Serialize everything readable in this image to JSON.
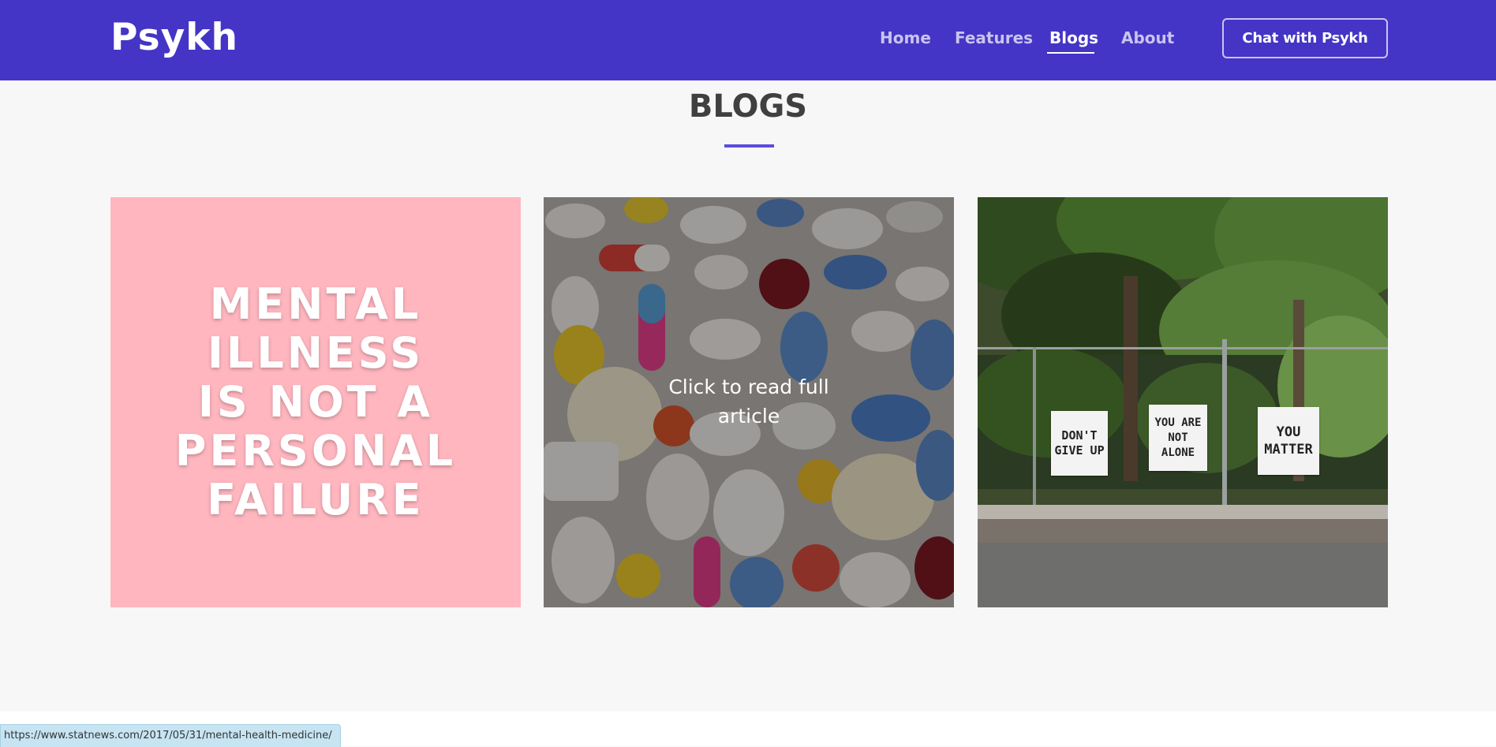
{
  "navbar": {
    "brand": "Psykh",
    "links": [
      {
        "label": "Home",
        "active": false
      },
      {
        "label": "Features",
        "active": false
      },
      {
        "label": "Blogs",
        "active": true
      },
      {
        "label": "About",
        "active": false
      }
    ],
    "cta_label": "Chat with Psykh",
    "background_color": "#4435c6"
  },
  "section": {
    "title": "BLOGS",
    "accent_color": "#5a4de0"
  },
  "cards": [
    {
      "image_text": "MENTAL\nILLNESS\nIS NOT A\nPERSONAL\nFAILURE",
      "background_color": "#ffb6bf"
    },
    {
      "image_subject": "assorted pills and capsules",
      "hover_text": "Click to read full article"
    },
    {
      "image_subject": "signs on a chain-link fence under trees",
      "signs": [
        "DON'T\nGIVE UP",
        "YOU ARE\nNOT ALONE",
        "YOU\nMATTER"
      ]
    }
  ],
  "status_bar": {
    "url": "https://www.statnews.com/2017/05/31/mental-health-medicine/"
  }
}
